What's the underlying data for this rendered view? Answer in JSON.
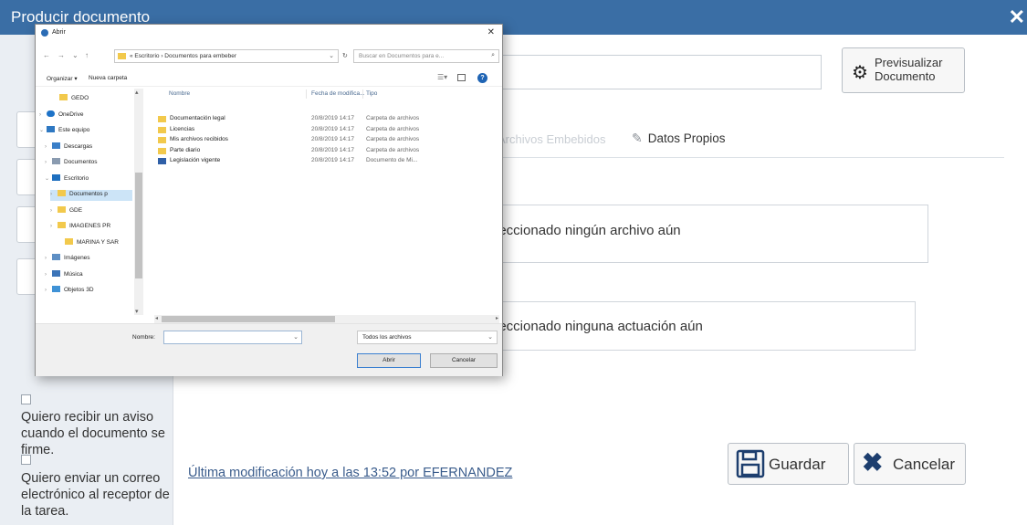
{
  "modal": {
    "title": "Producir documento",
    "close_glyph": "✕",
    "preview_button": "Previsualizar Documento",
    "tab_faded": "Archivos Embebidos",
    "tab_own": "Datos Propios",
    "box1_text": "leccionado ningún archivo aún",
    "box2_text": "leccionado ninguna actuación aún",
    "left": {
      "notify_text": "Quiero recibir un aviso cuando el documento se firme.",
      "email_text": "Quiero enviar un correo electrónico al receptor de la tarea."
    },
    "last_modified": "Última modificación hoy a las 13:52 por EFERNANDEZ",
    "save_label": "Guardar",
    "cancel_label": "Cancelar"
  },
  "dialog": {
    "title": "Abrir",
    "close_glyph": "✕",
    "path": "« Escritorio › Documentos para embeber",
    "search_placeholder": "Buscar en Documentos para e...",
    "organize": "Organizar ▾",
    "new_folder": "Nueva carpeta",
    "columns": {
      "name": "Nombre",
      "date": "Fecha de modifica...",
      "type": "Tipo"
    },
    "tree": [
      {
        "label": "GEDO",
        "icon": "folder-icon"
      },
      {
        "label": "OneDrive",
        "icon": "cloud-icon"
      },
      {
        "label": "Este equipo",
        "icon": "computer-icon"
      },
      {
        "label": "Descargas",
        "icon": "download-icon"
      },
      {
        "label": "Documentos",
        "icon": "documents-icon"
      },
      {
        "label": "Escritorio",
        "icon": "desktop-icon"
      },
      {
        "label": "Documentos p",
        "icon": "folder-icon"
      },
      {
        "label": "GDE",
        "icon": "folder-icon"
      },
      {
        "label": "IMAGENES PR",
        "icon": "folder-icon"
      },
      {
        "label": "MARINA Y SAR",
        "icon": "folder-icon"
      },
      {
        "label": "Imágenes",
        "icon": "pictures-icon"
      },
      {
        "label": "Música",
        "icon": "music-icon"
      },
      {
        "label": "Objetos 3D",
        "icon": "objects-3d-icon"
      }
    ],
    "files": [
      {
        "name": "Documentación legal",
        "date": "20/8/2019 14:17",
        "type": "Carpeta de archivos"
      },
      {
        "name": "Licencias",
        "date": "20/8/2019 14:17",
        "type": "Carpeta de archivos"
      },
      {
        "name": "Mis archivos recibidos",
        "date": "20/8/2019 14:17",
        "type": "Carpeta de archivos"
      },
      {
        "name": "Parte diario",
        "date": "20/8/2019 14:17",
        "type": "Carpeta de archivos"
      },
      {
        "name": "Legislación vigente",
        "date": "20/8/2019 14:17",
        "type": "Documento de Mi..."
      }
    ],
    "filename_label": "Nombre:",
    "filename_value": "",
    "filetype_value": "Todos los archivos",
    "open_label": "Abrir",
    "cancel_label": "Cancelar"
  }
}
